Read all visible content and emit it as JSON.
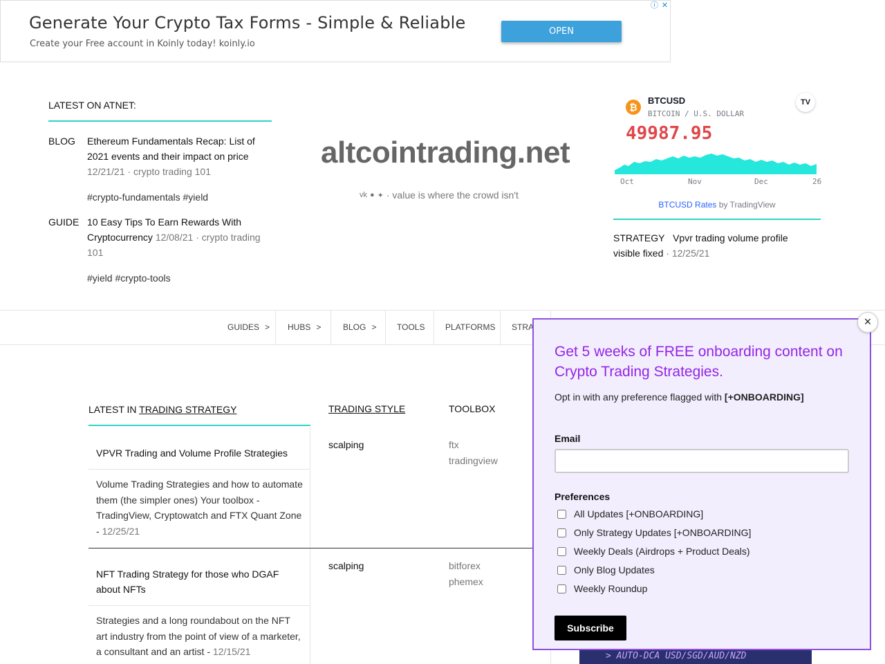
{
  "ad": {
    "title": "Generate Your Crypto Tax Forms - Simple & Reliable",
    "subtitle": "Create your Free account in Koinly today! koinly.io",
    "button": "OPEN",
    "info_icon": "ⓘ",
    "close_icon": "✕"
  },
  "latest": {
    "heading": "LATEST ON ATNET:",
    "items": [
      {
        "type": "BLOG",
        "title": "Ethereum Fundamentals Recap: List of 2021 events and their impact on price",
        "meta": "12/21/21 · crypto trading 101",
        "tags": "#crypto-fundamentals #yield"
      },
      {
        "type": "GUIDE",
        "title": "10 Easy Tips To Earn Rewards With Cryptocurrency",
        "meta": "12/08/21 · crypto trading 101",
        "tags": "#yield #crypto-tools"
      }
    ]
  },
  "logo": "altcointrading.net",
  "tagline": "· value is where the crowd isn't",
  "social_icons": [
    "vk-icon",
    "reddit-icon",
    "twitter-icon"
  ],
  "btc": {
    "symbol": "BTCUSD",
    "name": "BITCOIN / U.S. DOLLAR",
    "price": "49987.95",
    "axis": [
      "Oct",
      "Nov",
      "Dec",
      "26"
    ],
    "link_a": "BTCUSD Rates",
    "link_b": "by TradingView",
    "price_color": "#e0474b",
    "area_color": "#19e6d9"
  },
  "strategy_item": {
    "type": "STRATEGY",
    "title": "Vpvr trading volume profile visible fixed",
    "meta": "· 12/25/21"
  },
  "nav": [
    {
      "label": "GUIDES",
      "chev": ">"
    },
    {
      "label": "HUBS",
      "chev": ">"
    },
    {
      "label": "BLOG",
      "chev": ">"
    },
    {
      "label": "TOOLS",
      "chev": ""
    },
    {
      "label": "PLATFORMS",
      "chev": ""
    },
    {
      "label": "STRAT",
      "chev": ""
    }
  ],
  "table": {
    "latest_prefix": "LATEST IN",
    "latest_link": "TRADING STRATEGY",
    "col_style": "TRADING STYLE",
    "col_toolbox": "TOOLBOX",
    "rows": [
      {
        "title": "VPVR Trading and Volume Profile Strategies",
        "desc": "Volume Trading Strategies and how to automate them (the simpler ones) Your toolbox - TradingView, Cryptowatch and FTX Quant Zone -",
        "date": "12/25/21",
        "style": "scalping",
        "tools": [
          "ftx",
          "tradingview"
        ]
      },
      {
        "title": "NFT Trading Strategy for those who DGAF about NFTs",
        "desc": "Strategies and a long roundabout on the NFT art industry from the point of view of a marketer, a consultant and an artist -",
        "date": "12/15/21",
        "style": "scalping",
        "tools": [
          "bitforex",
          "phemex"
        ]
      }
    ]
  },
  "promo": "> AUTO-DCA USD/SGD/AUD/NZD",
  "popup": {
    "title": "Get 5 weeks of FREE onboarding content on Crypto Trading Strategies.",
    "sub_prefix": "Opt in with any preference flagged with",
    "sub_flag": "[+ONBOARDING]",
    "email_label": "Email",
    "email_value": "",
    "prefs_label": "Preferences",
    "options": [
      "All Updates [+ONBOARDING]",
      "Only Strategy Updates [+ONBOARDING]",
      "Weekly Deals (Airdrops + Product Deals)",
      "Only Blog Updates",
      "Weekly Roundup"
    ],
    "button": "Subscribe",
    "close": "×"
  }
}
